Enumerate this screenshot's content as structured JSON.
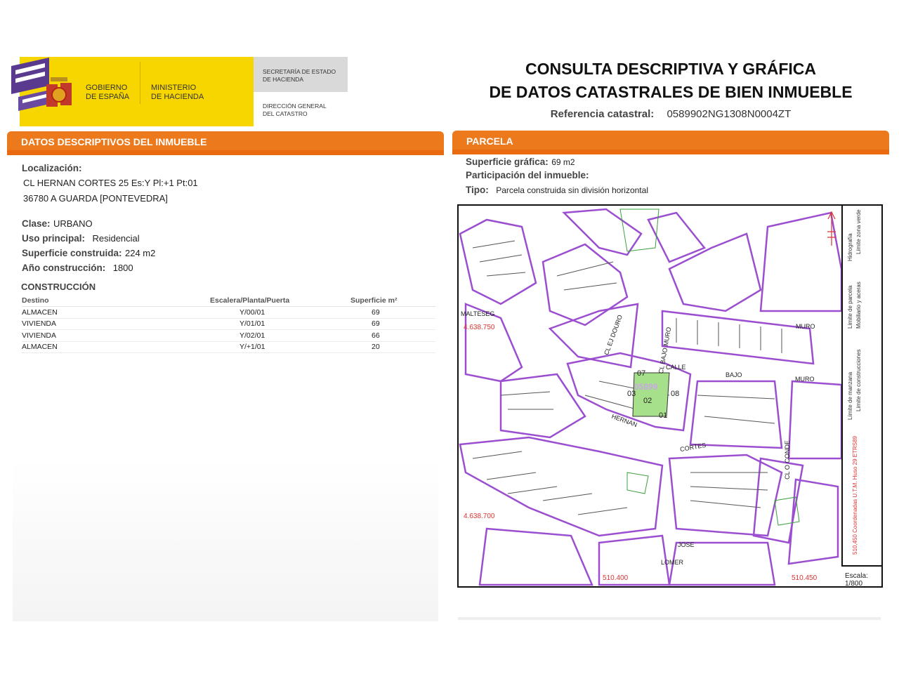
{
  "header": {
    "gov_line1": "GOBIERNO",
    "gov_line2": "DE ESPAÑA",
    "min_line1": "MINISTERIO",
    "min_line2": "DE HACIENDA",
    "sec_line1": "SECRETARÍA DE ESTADO",
    "sec_line2": "DE HACIENDA",
    "dir_line1": "DIRECCIÓN GENERAL",
    "dir_line2": "DEL CATASTRO",
    "title_line1": "CONSULTA DESCRIPTIVA Y GRÁFICA",
    "title_line2": "DE DATOS CATASTRALES DE BIEN INMUEBLE",
    "ref_label": "Referencia catastral:",
    "ref_value": "0589902NG1308N0004ZT"
  },
  "left": {
    "section_title": "DATOS DESCRIPTIVOS DEL INMUEBLE",
    "localizacion_label": "Localización:",
    "address_line1": "CL HERNAN CORTES 25 Es:Y Pl:+1 Pt:01",
    "address_line2": "36780 A GUARDA [PONTEVEDRA]",
    "clase_label": "Clase:",
    "clase_value": "URBANO",
    "uso_label": "Uso principal:",
    "uso_value": "Residencial",
    "sup_label": "Superficie construida:",
    "sup_value": "224 m2",
    "anio_label": "Año construcción:",
    "anio_value": "1800",
    "construccion_title": "CONSTRUCCIÓN",
    "table": {
      "headers": [
        "Destino",
        "Escalera/Planta/Puerta",
        "Superficie m²"
      ],
      "rows": [
        [
          "ALMACEN",
          "Y/00/01",
          "69"
        ],
        [
          "VIVIENDA",
          "Y/01/01",
          "69"
        ],
        [
          "VIVIENDA",
          "Y/02/01",
          "66"
        ],
        [
          "ALMACEN",
          "Y/+1/01",
          "20"
        ]
      ]
    }
  },
  "right": {
    "section_title": "PARCELA",
    "sup_grafica_label": "Superficie gráfica:",
    "sup_grafica_value": "69 m2",
    "participacion_label": "Participación del inmueble:",
    "tipo_label": "Tipo:",
    "tipo_value": "Parcela construida sin división horizontal"
  },
  "map": {
    "street_labels": {
      "calle_bajo_muro": "CL BAJO MURO",
      "calle": "CALLE",
      "bajo": "BAJO",
      "muro": "MURO",
      "muro2": "MURO",
      "hernan": "HERNAN",
      "cortes": "CORTES",
      "conde": "CL O CONDE",
      "jose": "JOSE",
      "lomer": "LOMER",
      "malteseg": "MALTESEG",
      "clejador": "CL EJ DOURO",
      "clbajo2": "CL BAJO MURO"
    },
    "parcel_codes": [
      "07",
      "03",
      "02",
      "08",
      "01"
    ],
    "parcel_ref": "05899",
    "coord_y1": "4.638.750",
    "coord_y2": "4.638.700",
    "coord_x1": "510.400",
    "coord_x2": "510.450",
    "legend": {
      "l1": "Límite de manzana",
      "l2": "Límite de parcela",
      "l3": "Límite de construcciones",
      "l4": "Mobiliario y aceras",
      "l5": "Límite zona verde",
      "l6": "Hidrografía",
      "coords": "510,450 Coordenadas U.T.M. Huso 29 ETRS89"
    },
    "escala_label": "Escala:",
    "escala_value": "1/800"
  },
  "colors": {
    "orange": "#ec7a1c",
    "yellow": "#f7d600",
    "block_line": "#9b4fd0",
    "green_parcel": "#a6e08a"
  }
}
